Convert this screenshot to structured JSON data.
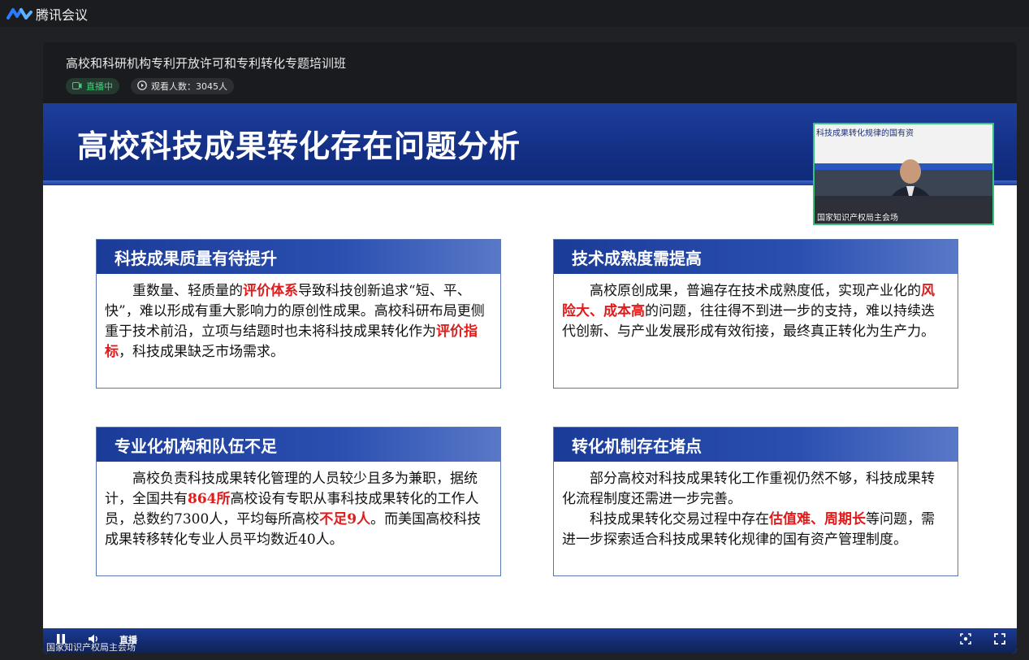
{
  "app": {
    "name": "腾讯会议",
    "accent": "#1e6fff"
  },
  "meeting": {
    "title": "高校和科研机构专利开放许可和专利转化专题培训班",
    "live_status": "直播中",
    "viewers": "观看人数：3045人",
    "live_color": "#3ed17a"
  },
  "slide": {
    "title": "高校科技成果转化存在问题分析",
    "pip_sign": "科技成果转化规律的国有资",
    "pip_caption": "国家知识产权局主会场",
    "cards": [
      {
        "title": "科技成果质量有待提升",
        "body": [
          [
            "重数量、轻质量的",
            ""
          ],
          [
            "评价体系",
            "hl"
          ],
          [
            "导致科技创新追求“短、平、快”，难以形成有重大影响力的原创性成果。高校科研布局更侧重于技术前沿，立项与结题时也未将科技成果转化作为",
            ""
          ],
          [
            "评价指标",
            "hl"
          ],
          [
            "，科技成果缺乏市场需求。",
            ""
          ]
        ]
      },
      {
        "title": "技术成熟度需提高",
        "body": [
          [
            "高校原创成果，普遍存在技术成熟度低，实现产业化的",
            ""
          ],
          [
            "风险大、成本高",
            "hl"
          ],
          [
            "的问题，往往得不到进一步的支持，难以持续迭代创新、与产业发展形成有效衔接，最终真正转化为生产力。",
            ""
          ]
        ]
      },
      {
        "title": "专业化机构和队伍不足",
        "body": [
          [
            "高校负责科技成果转化管理的人员较少且多为兼职，据统计，全国共有",
            ""
          ],
          [
            "864所",
            "hl"
          ],
          [
            "高校设有专职从事科技成果转化的工作人员，总数约7300人，平均每所高校",
            ""
          ],
          [
            "不足9人",
            "hl"
          ],
          [
            "。而美国高校科技成果转移转化专业人员平均数近40人。",
            ""
          ]
        ]
      },
      {
        "title": "转化机制存在堵点",
        "body": [
          [
            "部分高校对科技成果转化工作重视仍然不够，科技成果转化流程制度还需进一步完善。",
            ""
          ]
        ],
        "body2": [
          [
            "科技成果转化交易过程中存在",
            ""
          ],
          [
            "估值难、周期长",
            "hl"
          ],
          [
            "等问题，需进一步探索适合科技成果转化规律的国有资产管理制度。",
            ""
          ]
        ]
      }
    ],
    "highlight_color": "#e01b1b",
    "banner_color": "#143086"
  },
  "controls": {
    "live_label": "直播",
    "watermark": "国家知识产权局主会场",
    "icons": [
      "pause-icon",
      "volume-icon",
      "screenshot-icon",
      "fullscreen-icon"
    ]
  }
}
